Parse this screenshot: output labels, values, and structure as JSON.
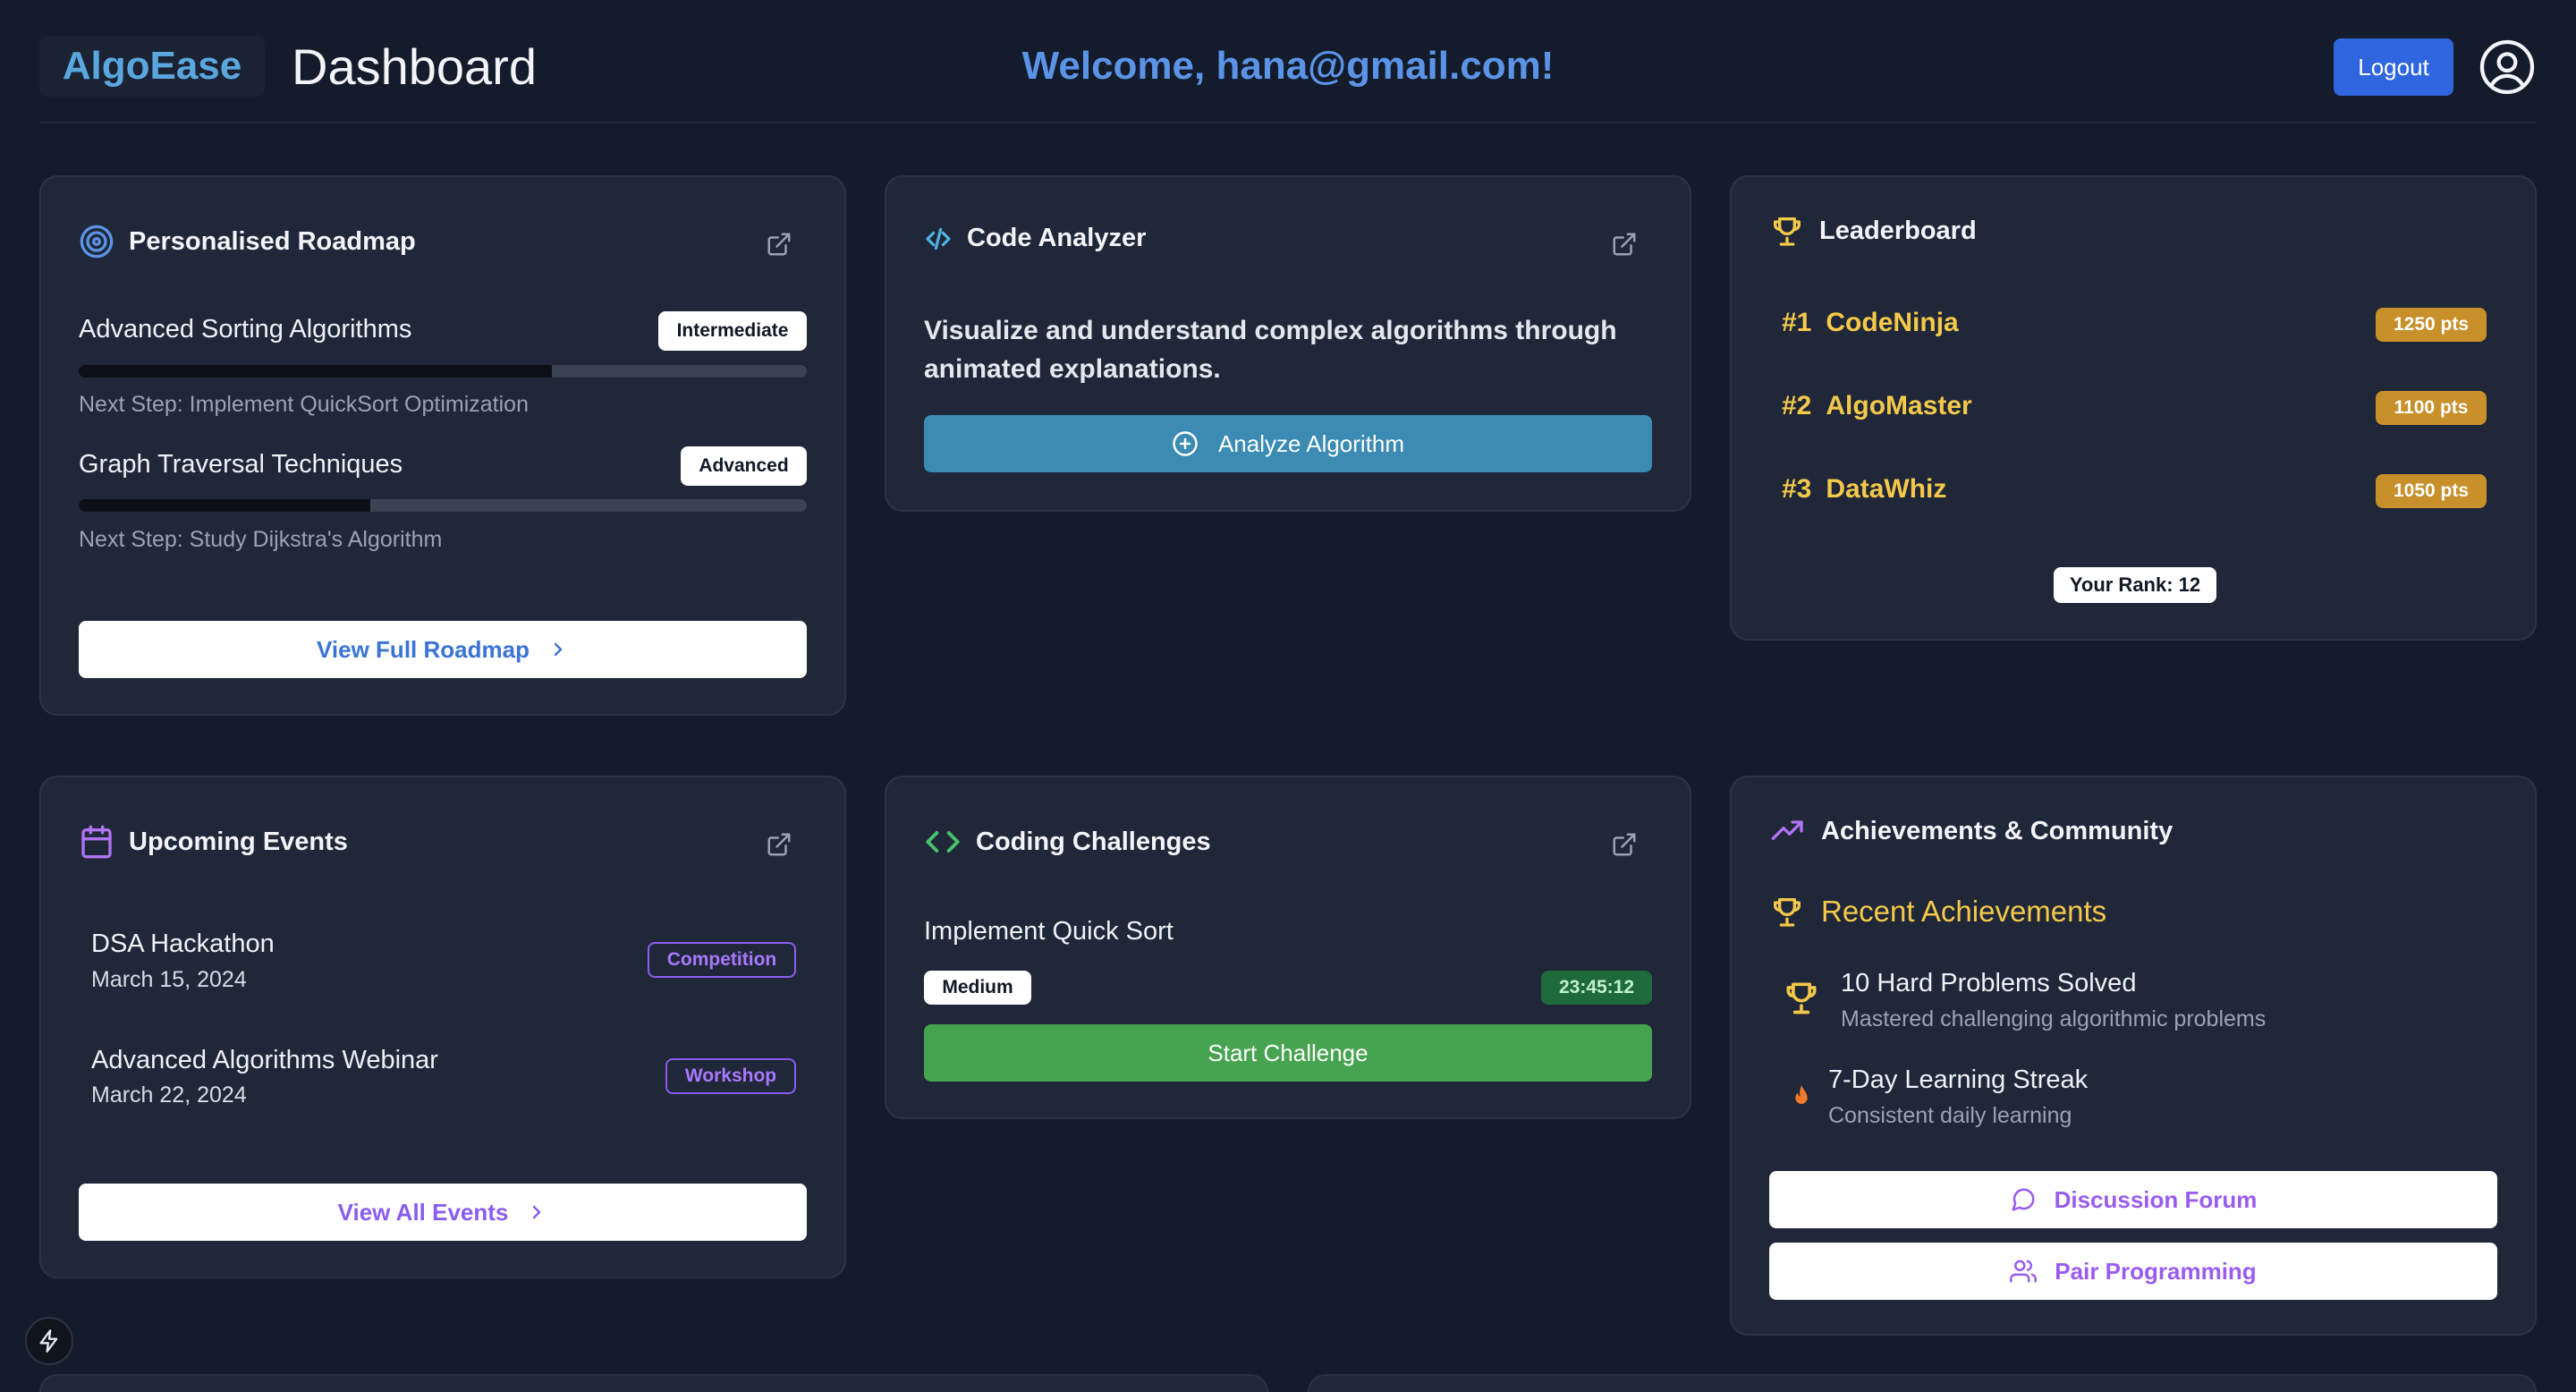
{
  "header": {
    "brand": "AlgoEase",
    "title": "Dashboard",
    "welcome": "Welcome, hana@gmail.com!",
    "logout_label": "Logout"
  },
  "roadmap": {
    "title": "Personalised Roadmap",
    "items": [
      {
        "title": "Advanced Sorting Algorithms",
        "level": "Intermediate",
        "progress": 0.65,
        "next_step": "Next Step: Implement QuickSort Optimization"
      },
      {
        "title": "Graph Traversal Techniques",
        "level": "Advanced",
        "progress": 0.4,
        "next_step": "Next Step: Study Dijkstra's Algorithm"
      }
    ],
    "button_label": "View Full Roadmap"
  },
  "analyzer": {
    "title": "Code Analyzer",
    "description": "Visualize and understand complex algorithms through animated explanations.",
    "button_label": "Analyze Algorithm"
  },
  "leaderboard": {
    "title": "Leaderboard",
    "entries": [
      {
        "rank": "#1",
        "name": "CodeNinja",
        "points": "1250 pts"
      },
      {
        "rank": "#2",
        "name": "AlgoMaster",
        "points": "1100 pts"
      },
      {
        "rank": "#3",
        "name": "DataWhiz",
        "points": "1050 pts"
      }
    ],
    "your_rank": "Your Rank: 12"
  },
  "events": {
    "title": "Upcoming Events",
    "items": [
      {
        "title": "DSA Hackathon",
        "date": "March 15, 2024",
        "type": "Competition"
      },
      {
        "title": "Advanced Algorithms Webinar",
        "date": "March 22, 2024",
        "type": "Workshop"
      }
    ],
    "button_label": "View All Events"
  },
  "challenges": {
    "title": "Coding Challenges",
    "challenge_title": "Implement Quick Sort",
    "difficulty": "Medium",
    "timer": "23:45:12",
    "button_label": "Start Challenge"
  },
  "achievements": {
    "title": "Achievements & Community",
    "section_title": "Recent Achievements",
    "items": [
      {
        "title": "10 Hard Problems Solved",
        "subtitle": "Mastered challenging algorithmic problems"
      },
      {
        "title": "7-Day Learning Streak",
        "subtitle": "Consistent daily learning"
      }
    ],
    "forum_label": "Discussion Forum",
    "pair_label": "Pair Programming"
  },
  "colors": {
    "background": "#141b2b",
    "card": "#1f2738",
    "brand_blue": "#5aa7e0",
    "primary_button": "#2f66e0",
    "gold": "#f4c94a",
    "purple": "#a978ff",
    "green": "#46a34f",
    "teal": "#3b8bb3"
  },
  "icons": [
    "target-icon",
    "external-link-icon",
    "chevron-right-icon",
    "code-icon",
    "plus-circle-icon",
    "trophy-icon",
    "calendar-icon",
    "trending-up-icon",
    "flame-icon",
    "message-circle-icon",
    "users-icon",
    "user-circle-icon",
    "bolt-icon"
  ]
}
